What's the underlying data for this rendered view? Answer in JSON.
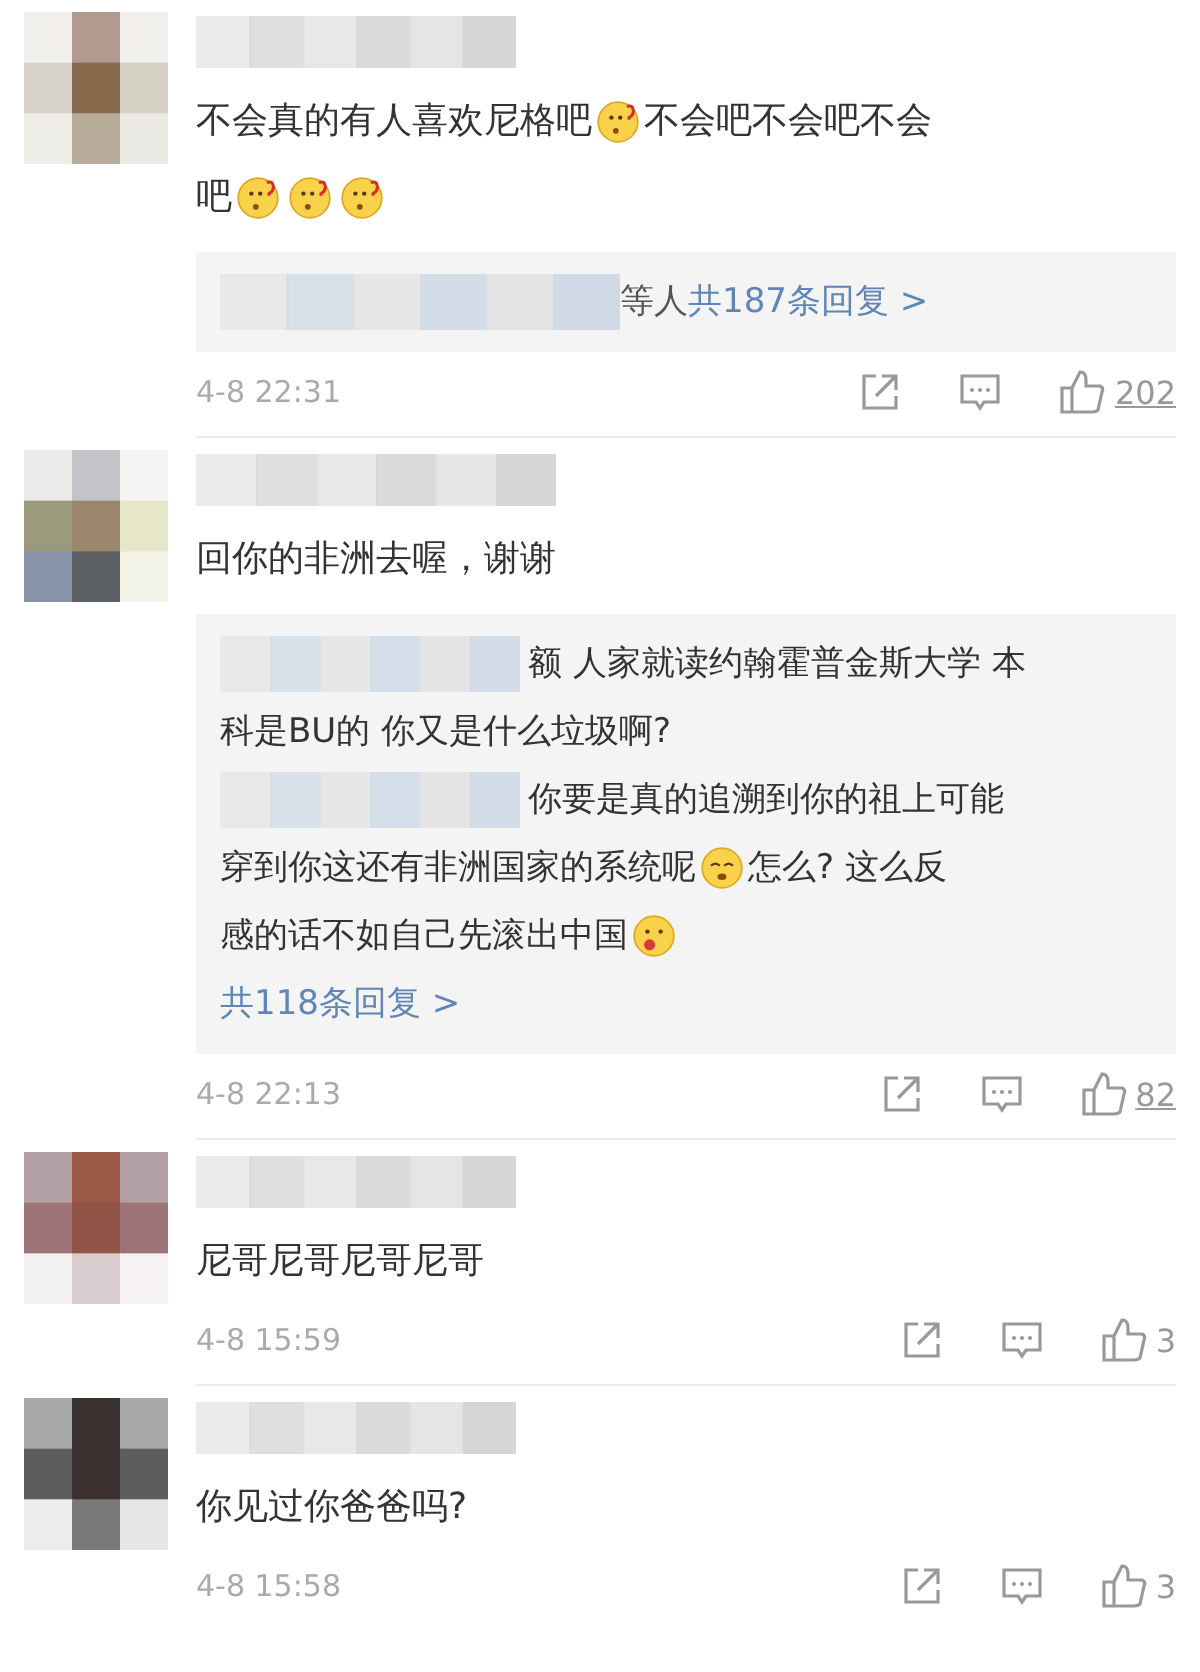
{
  "comments": [
    {
      "lines": [
        [
          {
            "kind": "text",
            "text": "不会真的有人喜欢尼格吧"
          },
          {
            "kind": "emoji-question"
          },
          {
            "kind": "text",
            "text": "不会吧不会吧不会"
          }
        ],
        [
          {
            "kind": "text",
            "text": "吧"
          },
          {
            "kind": "emoji-question"
          },
          {
            "kind": "emoji-question"
          },
          {
            "kind": "emoji-question"
          }
        ]
      ],
      "thread": {
        "summary_suffix": "等人",
        "more": "共187条回复 >"
      },
      "time": "4-8 22:31",
      "likes": "202"
    },
    {
      "lines": [
        [
          {
            "kind": "text",
            "text": "回你的非洲去喔，谢谢"
          }
        ]
      ],
      "thread": {
        "replies": [
          {
            "lines": [
              [
                {
                  "kind": "text",
                  "text": "额 人家就读约翰霍普金斯大学 本"
                }
              ],
              [
                {
                  "kind": "text",
                  "text": "科是BU的 你又是什么垃圾啊?"
                }
              ]
            ]
          },
          {
            "lines": [
              [
                {
                  "kind": "text",
                  "text": "你要是真的追溯到你的祖上可能"
                }
              ],
              [
                {
                  "kind": "text",
                  "text": "穿到你这还有非洲国家的系统呢"
                },
                {
                  "kind": "emoji-worried"
                },
                {
                  "kind": "text",
                  "text": "怎么? 这么反"
                }
              ],
              [
                {
                  "kind": "text",
                  "text": "感的话不如自己先滚出中国"
                },
                {
                  "kind": "emoji-tongue"
                }
              ]
            ]
          }
        ],
        "more": "共118条回复 >"
      },
      "time": "4-8 22:13",
      "likes": "82"
    },
    {
      "lines": [
        [
          {
            "kind": "text",
            "text": "尼哥尼哥尼哥尼哥"
          }
        ]
      ],
      "time": "4-8 15:59",
      "likes": "3"
    },
    {
      "lines": [
        [
          {
            "kind": "text",
            "text": "你见过你爸爸吗?"
          }
        ]
      ],
      "time": "4-8 15:58",
      "likes": "3"
    }
  ]
}
